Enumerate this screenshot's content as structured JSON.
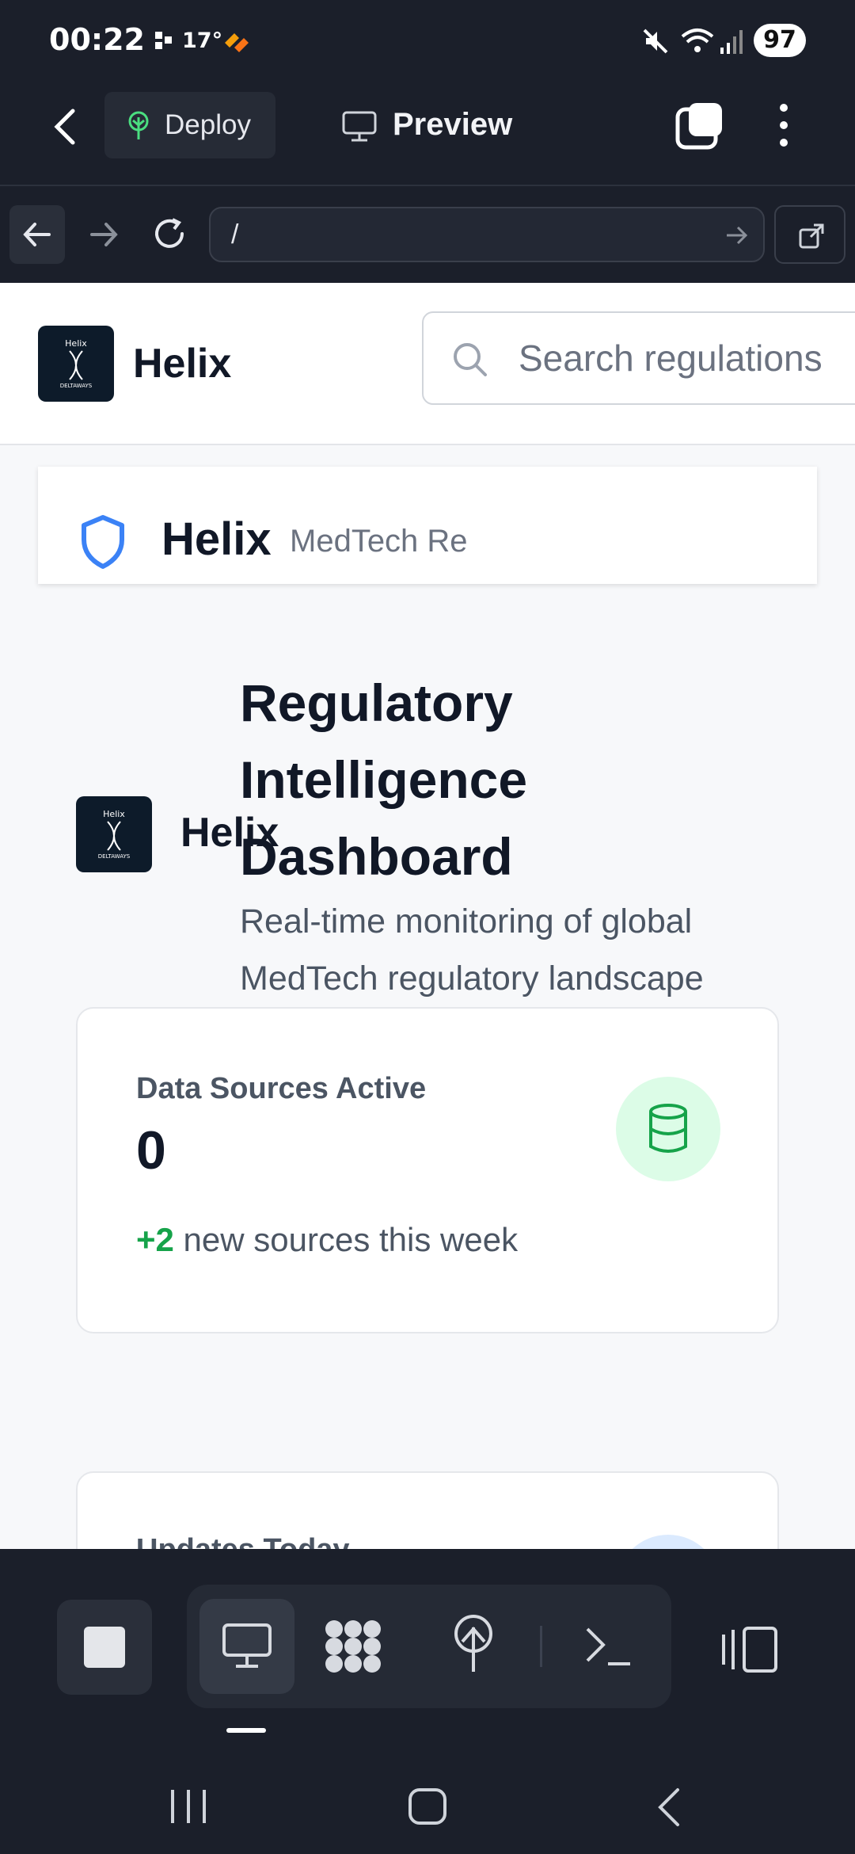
{
  "status_bar": {
    "time": "00:22",
    "temperature": "17°",
    "battery": "97"
  },
  "app_toolbar": {
    "deploy_label": "Deploy",
    "preview_label": "Preview"
  },
  "browser": {
    "url": "/"
  },
  "site": {
    "title": "Helix",
    "logo_text_top": "Helix",
    "logo_text_bottom": "DELTAWAYS"
  },
  "app_header": {
    "title": "Helix",
    "subtitle": "MedTech Re",
    "search_placeholder": "Search regulations"
  },
  "hero": {
    "brand": "Helix",
    "title": "Regulatory Intelligence Dashboard",
    "subtitle": "Real-time monitoring of global MedTech regulatory landscape"
  },
  "cards": [
    {
      "label": "Data Sources Active",
      "value": "0",
      "delta": "+2",
      "footnote": " new sources this week",
      "accent": "#16a34a"
    },
    {
      "label": "Updates Today",
      "accent": "#3b82f6"
    }
  ],
  "colors": {
    "bg_dark": "#1b1f2a",
    "accent_green": "#16a34a",
    "shield_blue": "#3b82f6"
  }
}
